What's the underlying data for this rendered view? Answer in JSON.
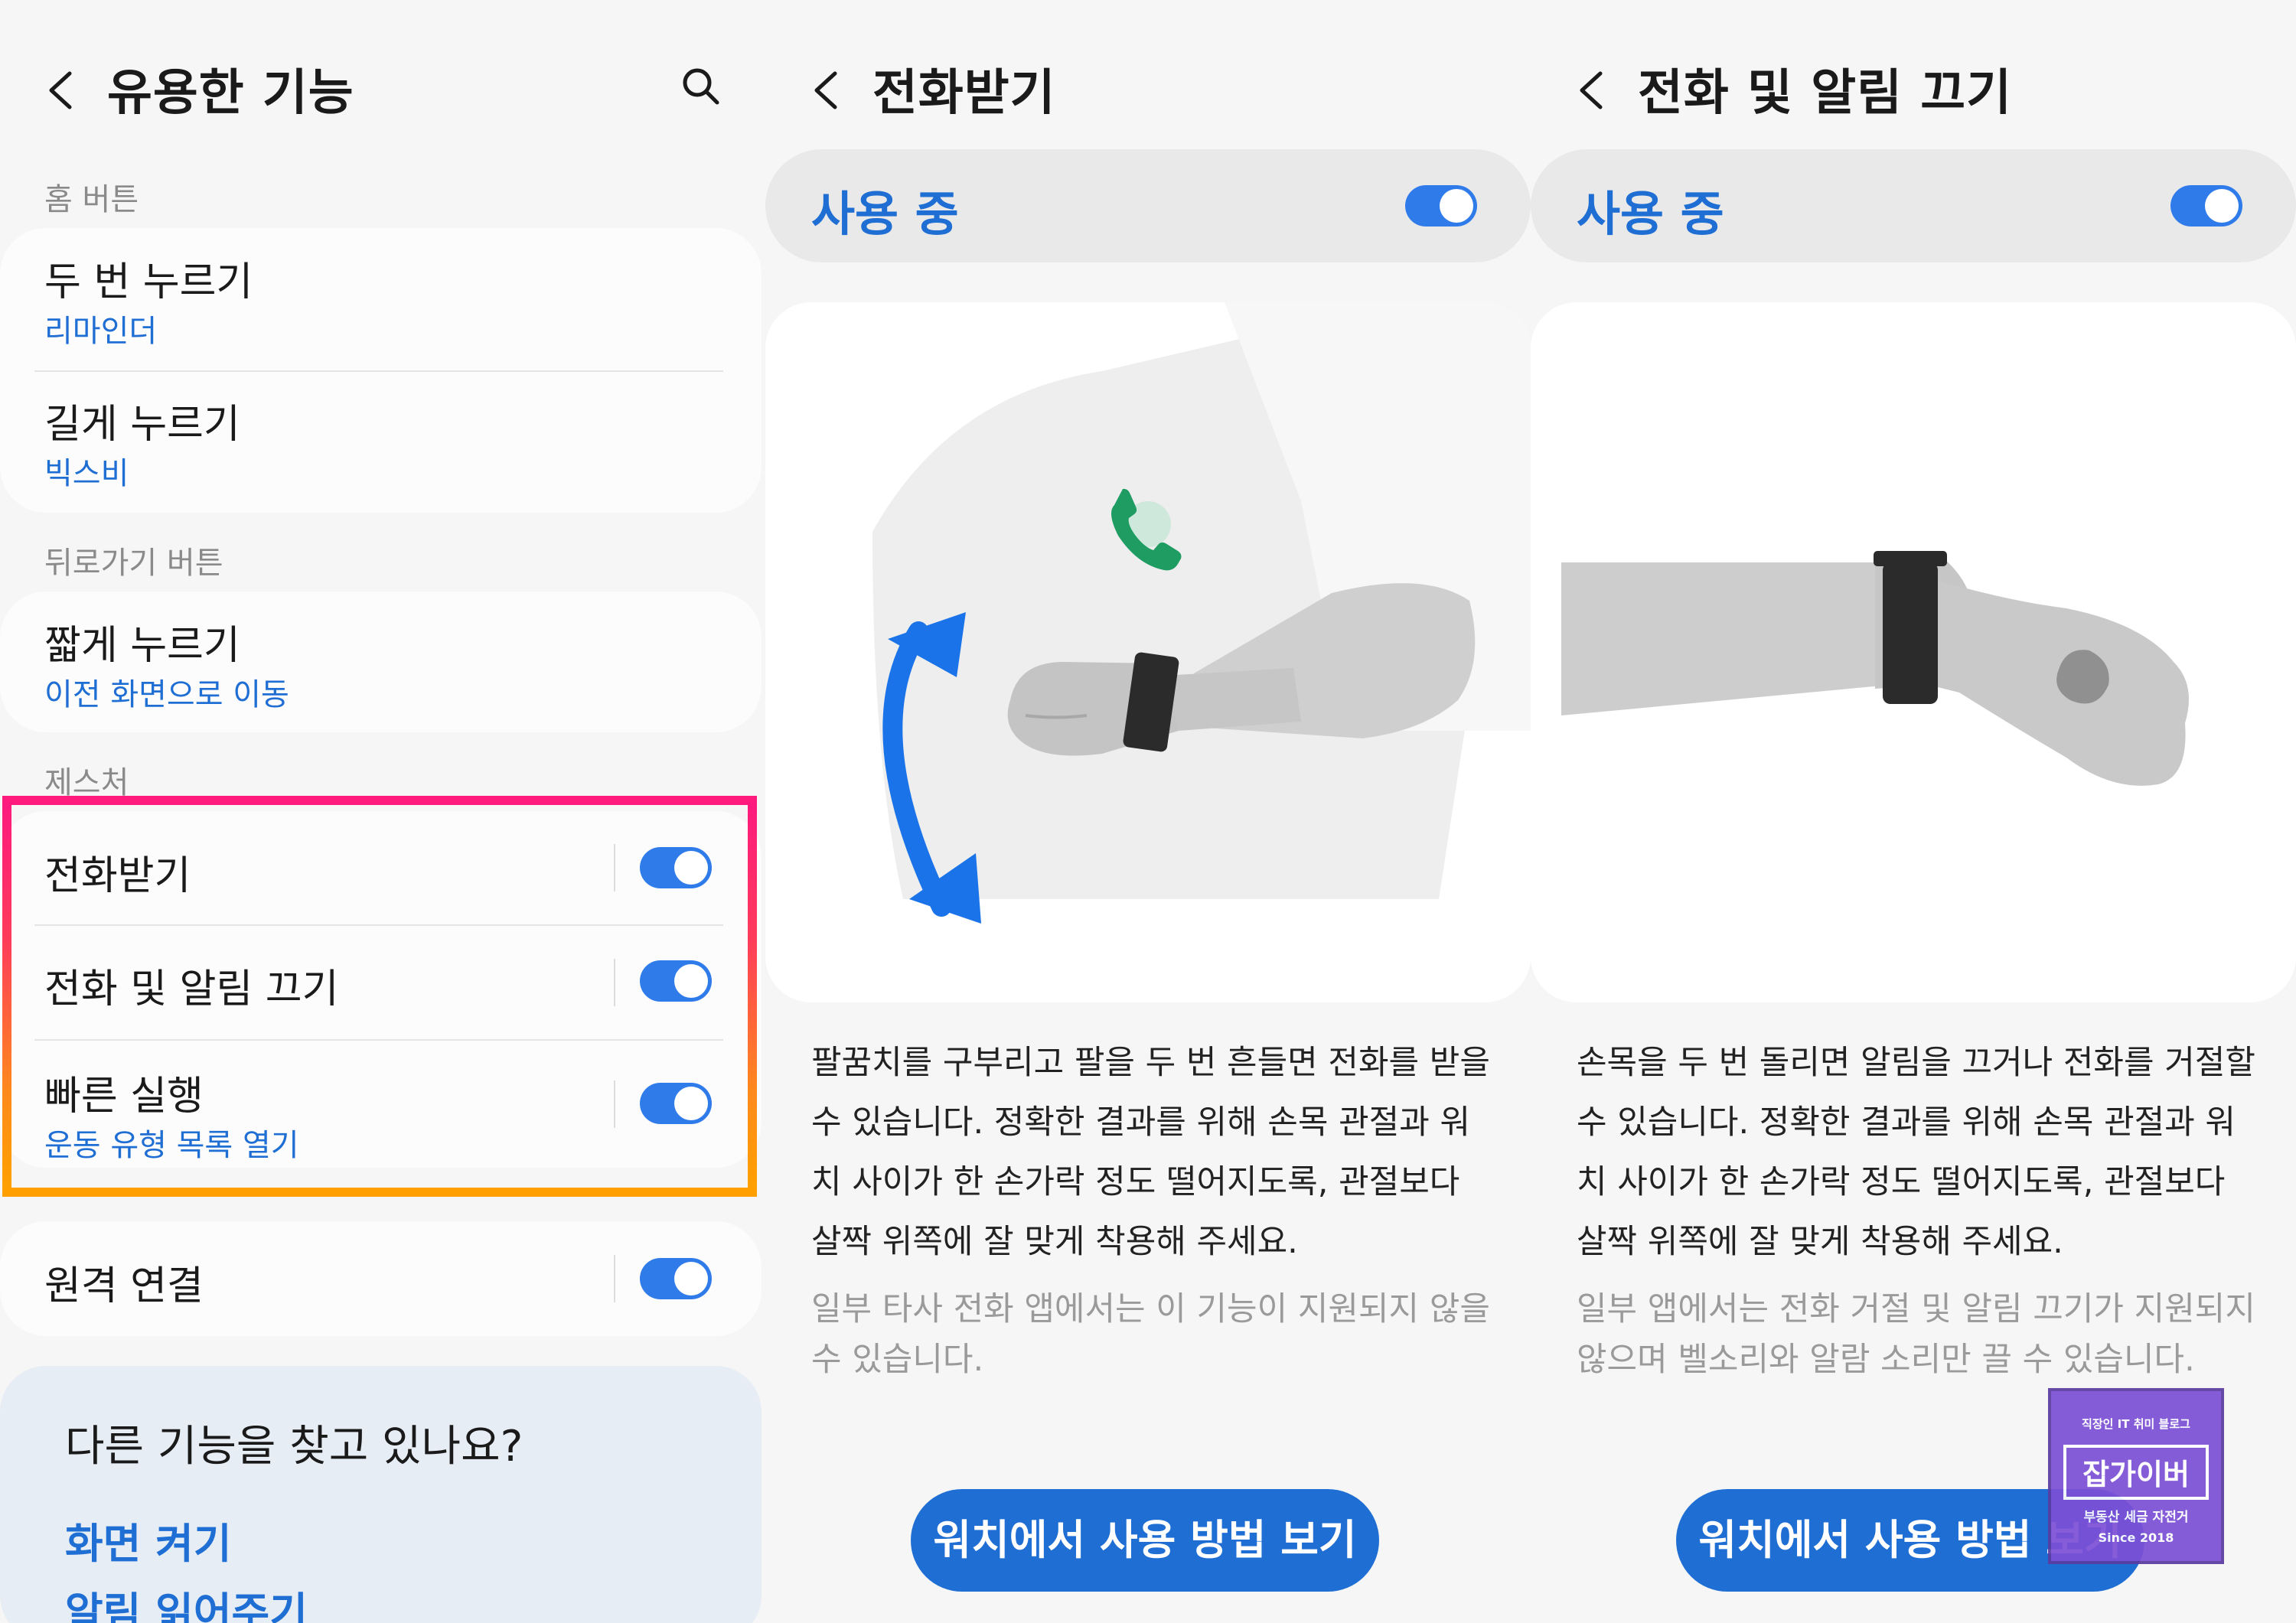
{
  "panel1": {
    "title": "유용한 기능",
    "sections": {
      "home": "홈 버튼",
      "back": "뒤로가기 버튼",
      "gesture": "제스처"
    },
    "home_items": [
      {
        "title": "두 번 누르기",
        "sub": "리마인더"
      },
      {
        "title": "길게 누르기",
        "sub": "빅스비"
      }
    ],
    "back_item": {
      "title": "짧게 누르기",
      "sub": "이전 화면으로 이동"
    },
    "gesture_items": [
      {
        "title": "전화받기",
        "on": true
      },
      {
        "title": "전화 및 알림 끄기",
        "on": true
      },
      {
        "title": "빠른 실행",
        "sub": "운동 유형 목록 열기",
        "on": true
      }
    ],
    "remote": {
      "title": "원격 연결",
      "on": true
    },
    "info": {
      "title": "다른 기능을 찾고 있나요?",
      "links": [
        "화면 켜기",
        "알림 읽어주기"
      ]
    }
  },
  "panel2": {
    "title": "전화받기",
    "status": "사용 중",
    "status_on": true,
    "description": "팔꿈치를 구부리고 팔을 두 번 흔들면 전화를 받을 수 있습니다. 정확한 결과를 위해 손목 관절과 워치 사이가 한 손가락 정도 떨어지도록, 관절보다 살짝 위쪽에 잘 맞게 착용해 주세요.",
    "note": "일부 타사 전화 앱에서는 이 기능이 지원되지 않을 수 있습니다.",
    "cta": "워치에서 사용 방법 보기"
  },
  "panel3": {
    "title": "전화 및 알림 끄기",
    "status": "사용 중",
    "status_on": true,
    "description": "손목을 두 번 돌리면 알림을 끄거나 전화를 거절할 수 있습니다. 정확한 결과를 위해 손목 관절과 워치 사이가 한 손가락 정도 떨어지도록, 관절보다 살짝 위쪽에 잘 맞게 착용해 주세요.",
    "note": "일부 앱에서는 전화 거절 및 알림 끄기가 지원되지 않으며 벨소리와 알람 소리만 끌 수 있습니다.",
    "cta": "워치에서 사용 방법 보기"
  },
  "watermark": {
    "top": "직장인 IT 취미 블로그",
    "big": "잡가이버",
    "sub": "부동산 세금 자전거",
    "since": "Since 2018"
  },
  "colors": {
    "accent": "#1f6ed4",
    "toggle": "#2f7bea",
    "highlight_top": "#ff1a7e",
    "highlight_bottom": "#ffa000",
    "call_icon": "#1e9c62"
  }
}
